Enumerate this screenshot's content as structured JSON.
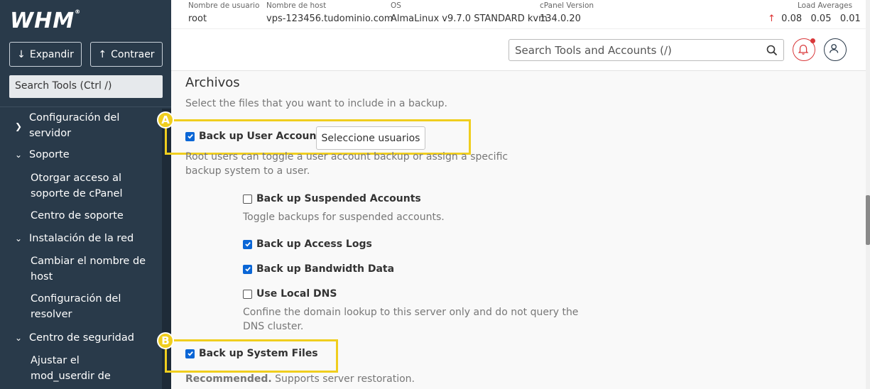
{
  "sidebar": {
    "logo": "WHM",
    "logo_mark": "®",
    "expand_label": "Expandir",
    "collapse_label": "Contraer",
    "search_placeholder": "Search Tools (Ctrl /)",
    "items": [
      {
        "label": "Configuración del servidor",
        "chevron": "right"
      },
      {
        "label": "Soporte",
        "chevron": "down"
      },
      {
        "label": "Otorgar acceso al soporte de cPanel"
      },
      {
        "label": "Centro de soporte"
      },
      {
        "label": "Instalación de la red",
        "chevron": "down"
      },
      {
        "label": "Cambiar el nombre de host"
      },
      {
        "label": "Configuración del resolver"
      },
      {
        "label": "Centro de seguridad",
        "chevron": "down"
      },
      {
        "label": "Ajustar el mod_userdir de"
      }
    ]
  },
  "header": {
    "username_label": "Nombre de usuario",
    "username": "root",
    "hostname_label": "Nombre de host",
    "hostname": "vps-123456.tudominio.com",
    "os_label": "OS",
    "os": "AlmaLinux v9.7.0 STANDARD kvm",
    "cpanel_label": "cPanel Version",
    "cpanel_version": "134.0.20",
    "load_label": "Load Averages",
    "load_values": "0.08   0.05   0.01",
    "search_placeholder": "Search Tools and Accounts (/)"
  },
  "content": {
    "title": "Archivos",
    "description": "Select the files that you want to include in a backup.",
    "backup_users_label": "Back up User Accounts",
    "select_users_button": "Seleccione usuarios",
    "backup_users_help_1": "Root users can toggle a user account backup or assign a specific",
    "backup_users_help_2": "backup system to a user.",
    "suspended_label": "Back up Suspended Accounts",
    "suspended_help": "Toggle backups for suspended accounts.",
    "access_logs_label": "Back up Access Logs",
    "bandwidth_label": "Back up Bandwidth Data",
    "local_dns_label": "Use Local DNS",
    "local_dns_help_1": "Confine the domain lookup to this server only and do not query the",
    "local_dns_help_2": "DNS cluster.",
    "system_files_label": "Back up System Files",
    "recommended_bold": "Recommended.",
    "recommended_text": " Supports server restoration.",
    "badge_a": "A",
    "badge_b": "B",
    "checks": {
      "backup_users": true,
      "suspended": false,
      "access_logs": true,
      "bandwidth": true,
      "local_dns": false,
      "system_files": true
    }
  },
  "colors": {
    "sidebar_bg": "#293a4a",
    "checkbox_blue": "#0a66d6",
    "highlight_yellow": "#f0ce1e",
    "alert_red": "#d9383a"
  }
}
